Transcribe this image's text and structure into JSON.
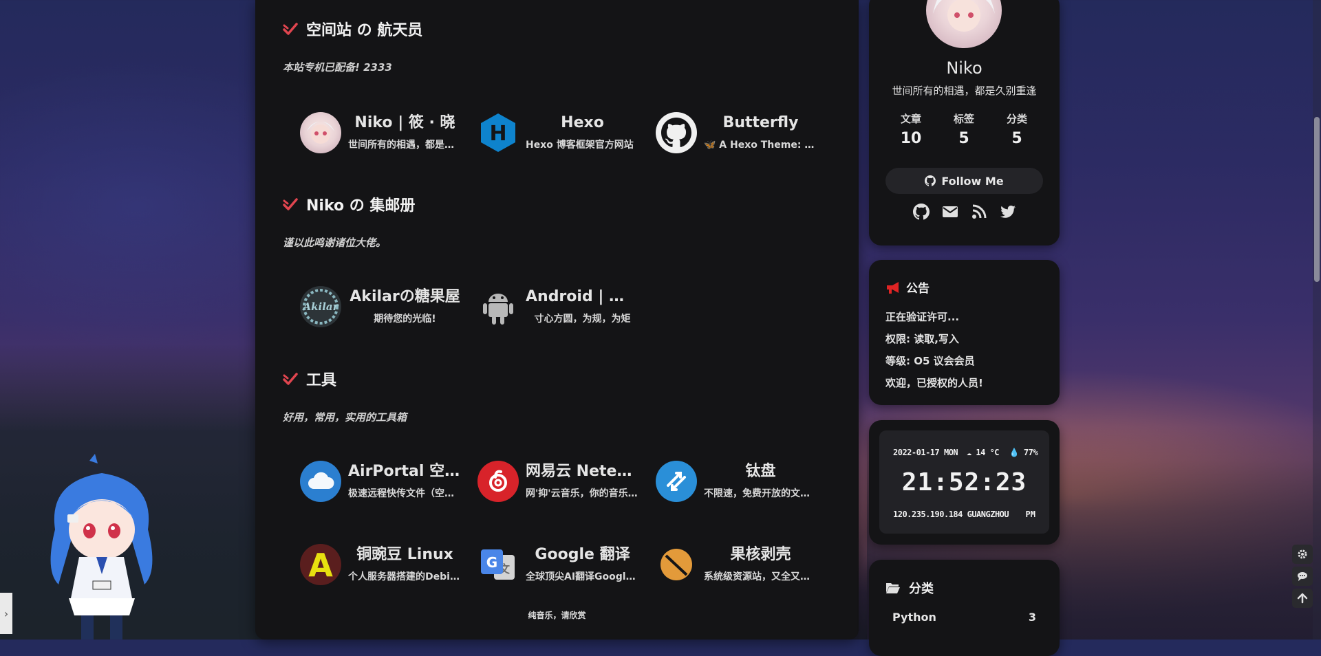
{
  "sections": [
    {
      "title": "空间站 の 航天员",
      "desc": "本站专机已配备! 2333",
      "links": [
        {
          "name": "Niko | 筱 · 晓",
          "desc": "世间所有的相遇，都是久别重逢",
          "icon": "avatar-niko"
        },
        {
          "name": "Hexo",
          "desc": "Hexo 博客框架官方网站",
          "icon": "hexo-icon",
          "color": "#0e83cd"
        },
        {
          "name": "Butterfly",
          "desc": "🦋 A Hexo Theme: Butterfly",
          "icon": "github-icon"
        }
      ]
    },
    {
      "title": "Niko の 集邮册",
      "desc": "谨以此鸣谢诸位大佬。",
      "links": [
        {
          "name": "Akilarの糖果屋",
          "desc": "期待您的光临!",
          "icon": "akilar-avatar"
        },
        {
          "name": "Android | 安卓",
          "desc": "寸心方圆，为规，为矩",
          "icon": "android-icon"
        }
      ]
    },
    {
      "title": "工具",
      "desc": "好用，常用，实用的工具箱",
      "links": [
        {
          "name": "AirPortal 空投快传",
          "desc": "极速远程快传文件（空投）",
          "icon": "airportal-icon",
          "color": "#2b7fd0"
        },
        {
          "name": "网易云 NeteaseCloudMusic",
          "desc": "网'抑'云音乐，你的音乐伙伴",
          "icon": "netease-icon",
          "color": "#d8232a"
        },
        {
          "name": "钛盘",
          "desc": "不限速，免费开放的文件中转站",
          "icon": "tmp-icon",
          "color": "#2a8fd8"
        },
        {
          "name": "铜豌豆 Linux",
          "desc": "个人服务器搭建的Debian衍生版",
          "icon": "atzlinux-icon"
        },
        {
          "name": "Google 翻译",
          "desc": "全球顶尖AI翻译Google翻译",
          "icon": "google-translate-icon"
        },
        {
          "name": "果核剥壳",
          "desc": "系统级资源站，又全又好用",
          "icon": "ghxi-icon",
          "color": "#e39a3a"
        }
      ]
    }
  ],
  "footer_note": "纯音乐，请欣赏",
  "profile": {
    "name": "Niko",
    "motto": "世间所有的相遇，都是久别重逢",
    "stats": [
      {
        "label": "文章",
        "value": "10"
      },
      {
        "label": "标签",
        "value": "5"
      },
      {
        "label": "分类",
        "value": "5"
      }
    ],
    "follow_label": "Follow Me",
    "social_icons": [
      "github-icon",
      "mail-icon",
      "rss-icon",
      "twitter-icon"
    ]
  },
  "notice": {
    "title": "公告",
    "lines": [
      "正在验证许可...",
      "权限: 读取,写入",
      "等级: O5 议会会员",
      "欢迎，已授权的人员!"
    ]
  },
  "clock": {
    "date": "2022-01-17 MON",
    "weather": "14 °C",
    "humidity": "77%",
    "time": "21:52:23",
    "location": "120.235.190.184 GUANGZHOU",
    "ampm": "PM"
  },
  "categories": {
    "title": "分类",
    "items": [
      {
        "name": "Python",
        "count": "3"
      }
    ]
  },
  "colors": {
    "accent_red": "#e0454f",
    "card_bg": "#141416"
  }
}
